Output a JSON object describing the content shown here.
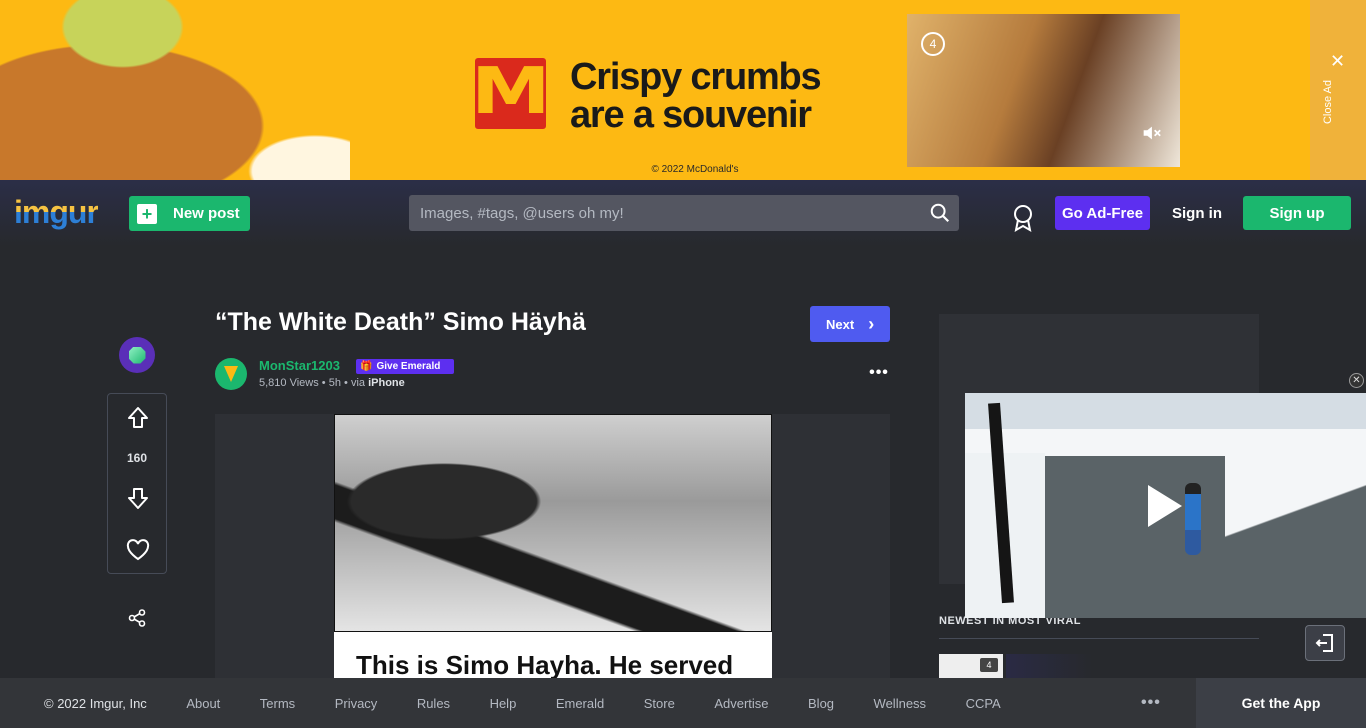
{
  "ad": {
    "headline_line1": "Crispy crumbs",
    "headline_line2": "are a souvenir",
    "copyright": "© 2022 McDonald's",
    "logo_letter": "M",
    "video_timer": "4",
    "close_label": "Close Ad",
    "brand_color": "#da291c",
    "background_color": "#fdb913"
  },
  "header": {
    "logo": "imgur",
    "new_post_label": "New post",
    "search_placeholder": "Images, #tags, @users oh my!",
    "go_ad_free_label": "Go Ad-Free",
    "sign_in_label": "Sign in",
    "sign_up_label": "Sign up"
  },
  "rail": {
    "vote_count": "160"
  },
  "post": {
    "title": "“The White Death” Simo Häyhä",
    "next_label": "Next",
    "author": "MonStar1203",
    "give_emerald_label": "Give Emerald",
    "views": "5,810 Views",
    "age": "5h",
    "via_prefix": "via",
    "via_device": "iPhone",
    "caption_text": "This is Simo Hayha. He served"
  },
  "sidebar": {
    "newest_title": "NEWEST IN MOST VIRAL",
    "thumb_badge": "4"
  },
  "footer": {
    "copyright": "© 2022 Imgur, Inc",
    "links": [
      "About",
      "Terms",
      "Privacy",
      "Rules",
      "Help",
      "Emerald",
      "Store",
      "Advertise",
      "Blog",
      "Wellness",
      "CCPA"
    ],
    "more": "•••",
    "get_app_label": "Get the App"
  },
  "colors": {
    "accent_green": "#1bb76e",
    "accent_purple": "#5d2ff0",
    "next_blue": "#4f5bf0",
    "page_bg": "#27292d"
  },
  "icons": {
    "search": "search-icon",
    "ribbon": "ribbon-icon",
    "upvote": "arrow-up-icon",
    "downvote": "arrow-down-icon",
    "favorite": "heart-icon",
    "share": "share-icon",
    "mute": "mute-icon",
    "exit": "exit-icon"
  }
}
